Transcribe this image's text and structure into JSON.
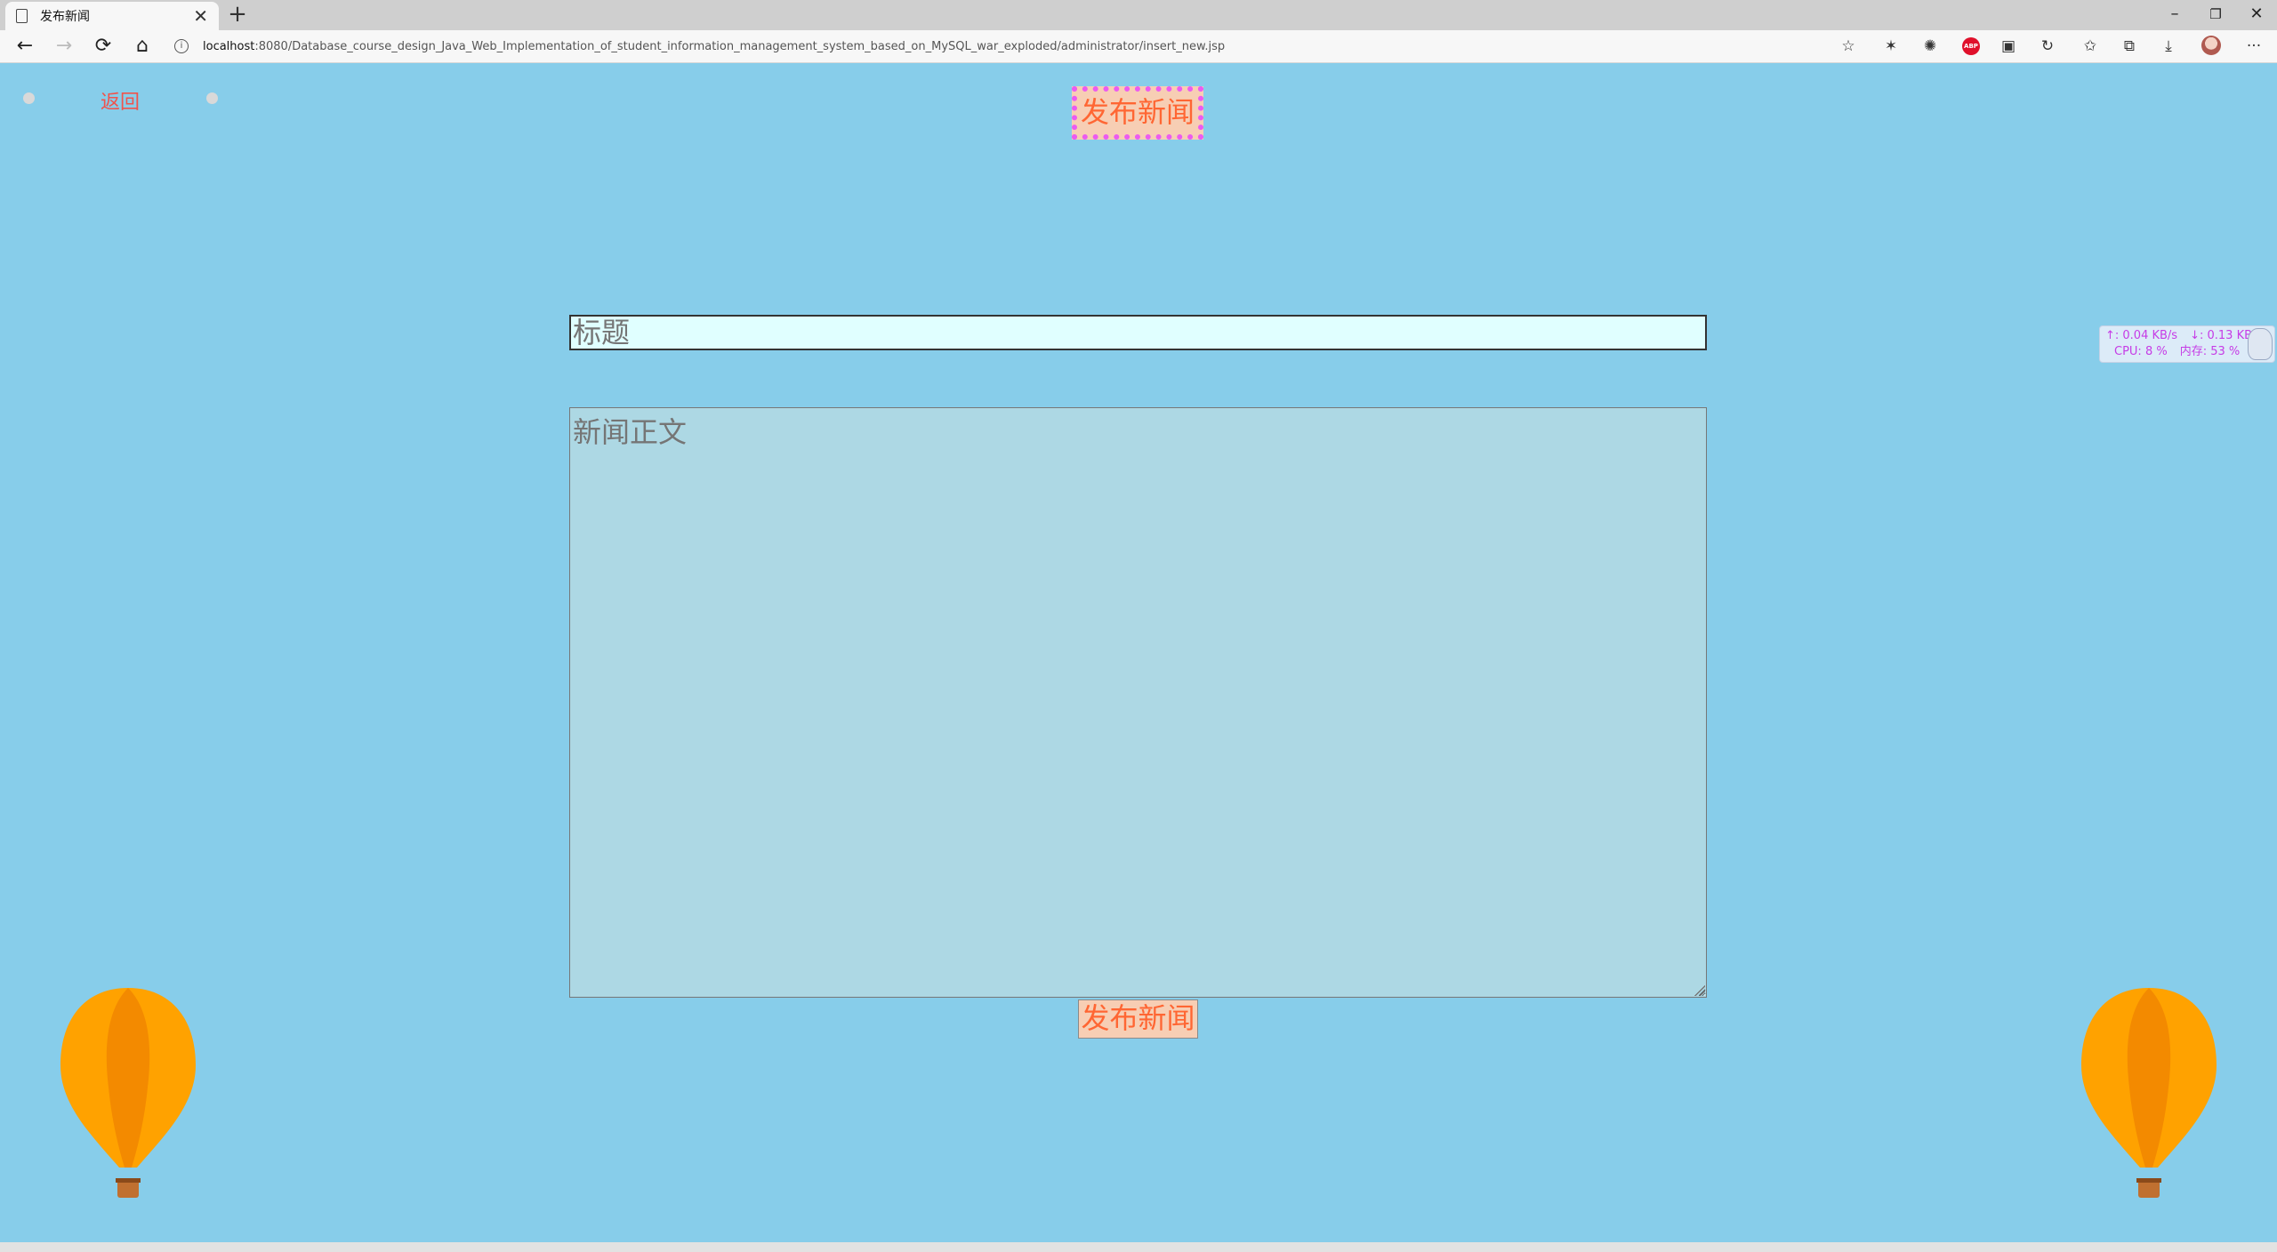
{
  "browser": {
    "tab_title": "发布新闻",
    "tab_close": "✕",
    "new_tab": "+",
    "url_host": "localhost",
    "url_path": ":8080/Database_course_design_Java_Web_Implementation_of_student_information_management_system_based_on_MySQL_war_exploded/administrator/insert_new.jsp",
    "window_controls": {
      "minimize": "–",
      "restore": "❐",
      "close": "✕"
    },
    "icons": [
      "star-add-icon",
      "extension-icon",
      "extension-icon",
      "adblock-icon",
      "collections-icon",
      "sync-icon",
      "favorites-icon",
      "collections-icon",
      "download-icon",
      "profile-avatar",
      "more-icon"
    ],
    "abp_label": "ABP",
    "more_label": "···"
  },
  "page": {
    "back_label": "返回",
    "title": "发布新闻",
    "title_placeholder": "标题",
    "body_placeholder": "新闻正文",
    "submit_label": "发布新闻"
  },
  "net_monitor": {
    "upload": "↑: 0.04 KB/s",
    "download": "↓: 0.13 KB/s",
    "cpu": "CPU: 8 %",
    "mem": "内存: 53 %"
  },
  "colors": {
    "background": "#87cdea",
    "accent_text": "#ff6633",
    "back_link": "#f0534c",
    "title_border": "#ec5bf0",
    "title_bg": "#f7ceb4",
    "balloon_orange": "#ffa200",
    "balloon_dark": "#f38a00",
    "basket": "#c07030"
  }
}
